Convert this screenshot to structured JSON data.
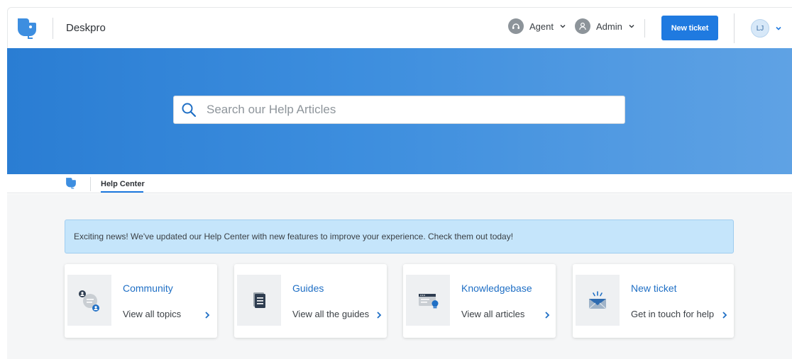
{
  "header": {
    "brand": "Deskpro",
    "agent_label": "Agent",
    "admin_label": "Admin",
    "new_ticket_label": "New ticket",
    "avatar_initials": "LJ"
  },
  "search": {
    "placeholder": "Search our Help Articles",
    "value": ""
  },
  "subnav": {
    "tab_label": "Help Center"
  },
  "banner": {
    "text": "Exciting news! We've updated our Help Center with new features to improve your experience. Check them out today!"
  },
  "cards": [
    {
      "title": "Community",
      "link": "View all topics",
      "icon": "community-icon"
    },
    {
      "title": "Guides",
      "link": "View all the guides",
      "icon": "document-icon"
    },
    {
      "title": "Knowledgebase",
      "link": "View all articles",
      "icon": "knowledgebase-icon"
    },
    {
      "title": "New ticket",
      "link": "Get in touch for help",
      "icon": "envelope-icon"
    }
  ],
  "colors": {
    "primary": "#1f7ae0",
    "hero_start": "#2a7dd3",
    "hero_end": "#5fa2e4",
    "banner_bg": "#c5e5fb",
    "link": "#1f6fc5"
  }
}
